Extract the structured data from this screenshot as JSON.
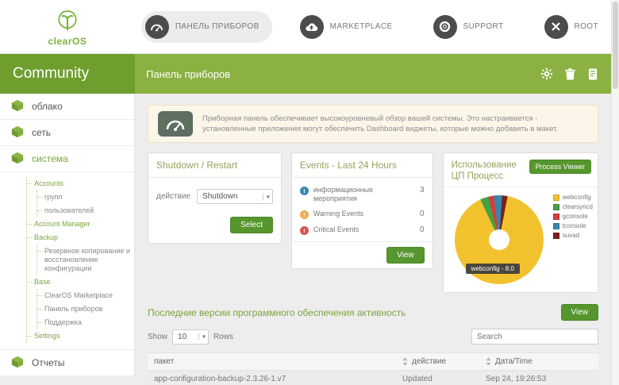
{
  "logo": {
    "text": "clearOS"
  },
  "nav": {
    "tabs": [
      {
        "label": "ПАНЕЛЬ ПРИБОРОВ"
      },
      {
        "label": "MARKETPLACE"
      },
      {
        "label": "SUPPORT"
      },
      {
        "label": "ROOT"
      }
    ]
  },
  "titlebar": {
    "community": "Community",
    "page_title": "Панель приборов"
  },
  "sidebar": {
    "items": [
      {
        "label": "облако"
      },
      {
        "label": "сеть"
      },
      {
        "label": "система"
      },
      {
        "label": "Отчеты"
      }
    ],
    "system_menu": {
      "accounts": "Accounts",
      "groups": "групп",
      "users": "пользователей",
      "account_manager": "Account Manager",
      "backup": "Backup",
      "backup_restore": "Резервное копирование и восстановление конфигурации",
      "base": "Base",
      "marketplace": "ClearOS Marketplace",
      "dashboard": "Панель приборов",
      "support": "Поддержка",
      "settings": "Settings"
    }
  },
  "info_banner": {
    "text": "Приборная панель обеспечивает высокоуровневый обзор вашей системы. Это настраивается - установленные приложения могут обеспечить Dashboard виджеты, которые можно добавить в макет."
  },
  "shutdown_panel": {
    "title": "Shutdown / Restart",
    "action_label": "действие",
    "selected_action": "Shutdown",
    "select_button": "Select"
  },
  "events_panel": {
    "title": "Events - Last 24 Hours",
    "rows": [
      {
        "label": "информационные мероприятия",
        "count": "3",
        "type": "info"
      },
      {
        "label": "Warning Events",
        "count": "0",
        "type": "warning"
      },
      {
        "label": "Critical Events",
        "count": "0",
        "type": "critical"
      }
    ],
    "view_button": "View"
  },
  "cpu_panel": {
    "title": "Использование ЦП Процесс",
    "process_viewer_button": "Process Viewer",
    "tooltip": "webconfig - 8.0",
    "chart_data": {
      "type": "pie",
      "title": "Использование ЦП Процесс",
      "legend_position": "right",
      "series": [
        {
          "name": "webconfig",
          "percent": 90,
          "color": "#f2c22e",
          "labeled_value": 8.0
        },
        {
          "name": "clearsyncd",
          "percent": 3,
          "color": "#46a046"
        },
        {
          "name": "gconsole",
          "percent": 2,
          "color": "#d43f3a"
        },
        {
          "name": "tconsole",
          "percent": 3,
          "color": "#3a87ad"
        },
        {
          "name": "suvad",
          "percent": 2,
          "color": "#7a2020"
        }
      ],
      "tooltip": "webconfig - 8.0"
    }
  },
  "activity_panel": {
    "title": "Последние версии программного обеспечения активность",
    "view_button": "View",
    "show_label": "Show",
    "rows_label": "Rows",
    "page_size": "10",
    "search_placeholder": "Search",
    "columns": [
      "пакет",
      "действие",
      "Дата/Time"
    ],
    "rows": [
      [
        "app-configuration-backup-2.3.26-1.v7",
        "Updated",
        "Sep 24, 19:26:53"
      ]
    ]
  },
  "colors": {
    "brand_green": "#7aa43c",
    "bar_left_green": "#6f9e2e",
    "bar_right_green": "#8ab141",
    "button_green": "#56962e",
    "info_blue": "#3a87ad",
    "warning_orange": "#f0ad4e",
    "critical_red": "#d9534f"
  }
}
